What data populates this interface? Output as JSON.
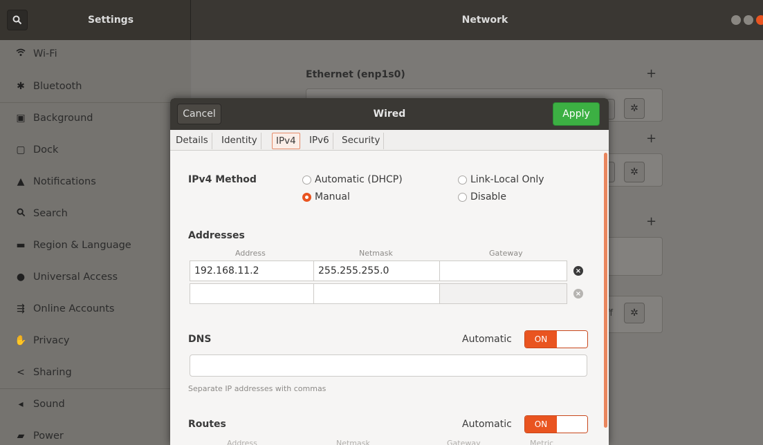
{
  "header": {
    "left_title": "Settings",
    "right_title": "Network"
  },
  "sidebar": {
    "items": [
      {
        "label": "Wi-Fi",
        "icon": "wifi-icon"
      },
      {
        "label": "Bluetooth",
        "icon": "bluetooth-icon"
      },
      {
        "label": "Background",
        "icon": "background-icon"
      },
      {
        "label": "Dock",
        "icon": "dock-icon"
      },
      {
        "label": "Notifications",
        "icon": "bell-icon"
      },
      {
        "label": "Search",
        "icon": "search-icon"
      },
      {
        "label": "Region & Language",
        "icon": "region-icon"
      },
      {
        "label": "Universal Access",
        "icon": "universal-access-icon"
      },
      {
        "label": "Online Accounts",
        "icon": "online-accounts-icon"
      },
      {
        "label": "Privacy",
        "icon": "hand-icon"
      },
      {
        "label": "Sharing",
        "icon": "share-icon"
      },
      {
        "label": "Sound",
        "icon": "speaker-icon"
      },
      {
        "label": "Power",
        "icon": "power-icon"
      }
    ]
  },
  "main": {
    "ethernet_title": "Ethernet (enp1s0)",
    "off_text": "ff"
  },
  "dialog": {
    "cancel": "Cancel",
    "title": "Wired",
    "apply": "Apply",
    "tabs": [
      "Details",
      "Identity",
      "IPv4",
      "IPv6",
      "Security"
    ],
    "active_tab": "IPv4",
    "ipv4_method_label": "IPv4 Method",
    "methods": {
      "auto": "Automatic (DHCP)",
      "link_local": "Link-Local Only",
      "manual": "Manual",
      "disable": "Disable"
    },
    "selected_method": "Manual",
    "addresses_label": "Addresses",
    "columns": {
      "address": "Address",
      "netmask": "Netmask",
      "gateway": "Gateway"
    },
    "rows": [
      {
        "address": "192.168.11.2",
        "netmask": "255.255.255.0",
        "gateway": ""
      },
      {
        "address": "",
        "netmask": "",
        "gateway": ""
      }
    ],
    "dns_label": "DNS",
    "automatic_label": "Automatic",
    "switch_on": "ON",
    "dns_value": "",
    "dns_hint": "Separate IP addresses with commas",
    "routes_label": "Routes",
    "route_cols": {
      "address": "Address",
      "netmask": "Netmask",
      "gateway": "Gateway",
      "metric": "Metric"
    }
  },
  "colors": {
    "accent": "#e95420",
    "apply_green": "#3cb043",
    "header_dark": "#3a3733"
  }
}
